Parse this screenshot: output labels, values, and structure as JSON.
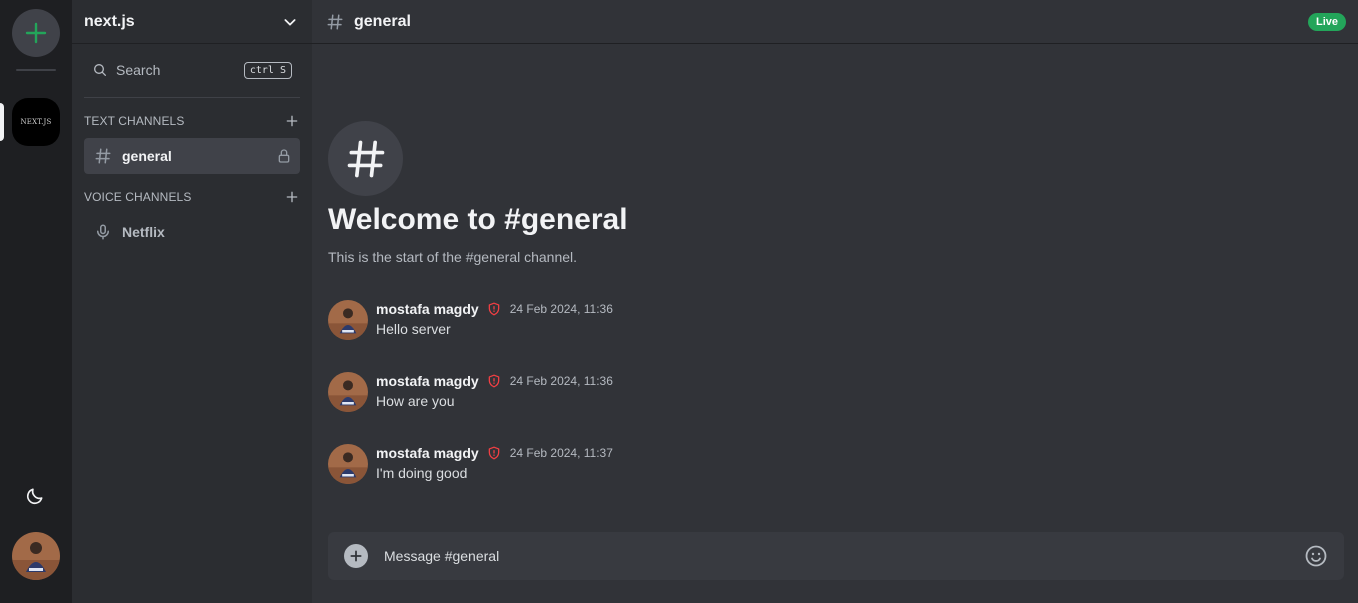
{
  "server_rail": {
    "add_server_icon": "plus-icon",
    "active_server_label": "NEXT.JS",
    "theme_icon": "moon-icon"
  },
  "sidebar": {
    "server_name": "next.js",
    "search": {
      "label": "Search",
      "shortcut": "ctrl S"
    },
    "text_section": {
      "title": "TEXT CHANNELS"
    },
    "text_channels": [
      {
        "name": "general",
        "icon": "hash-icon",
        "locked": true
      }
    ],
    "voice_section": {
      "title": "VOICE CHANNELS"
    },
    "voice_channels": [
      {
        "name": "Netflix",
        "icon": "mic-icon"
      }
    ]
  },
  "header": {
    "channel_name": "general",
    "status_badge": "Live"
  },
  "welcome": {
    "title": "Welcome to #general",
    "subtitle": "This is the start of the #general channel."
  },
  "messages": [
    {
      "author": "mostafa magdy",
      "timestamp": "24 Feb 2024, 11:36",
      "text": "Hello server"
    },
    {
      "author": "mostafa magdy",
      "timestamp": "24 Feb 2024, 11:36",
      "text": "How are you"
    },
    {
      "author": "mostafa magdy",
      "timestamp": "24 Feb 2024, 11:37",
      "text": "I'm doing good"
    }
  ],
  "composer": {
    "placeholder": "Message #general"
  },
  "colors": {
    "accent_green": "#23a55a",
    "admin_shield": "#f23f43",
    "rail_bg": "#1e1f22",
    "sidebar_bg": "#2b2d31",
    "main_bg": "#313338"
  }
}
